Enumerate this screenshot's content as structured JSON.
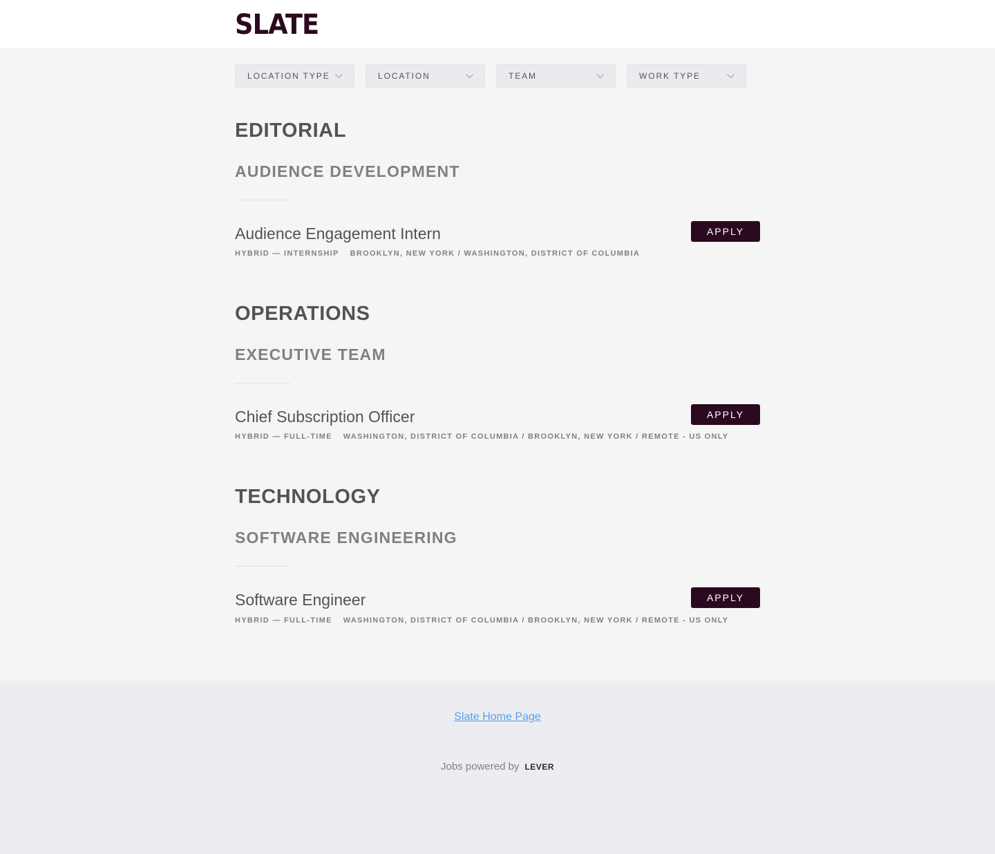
{
  "header": {
    "logo_text": "SLATE"
  },
  "filters": [
    {
      "label": "LOCATION TYPE"
    },
    {
      "label": "LOCATION"
    },
    {
      "label": "TEAM"
    },
    {
      "label": "WORK TYPE"
    }
  ],
  "groups": [
    {
      "department": "EDITORIAL",
      "team": "AUDIENCE DEVELOPMENT",
      "postings": [
        {
          "title": "Audience Engagement Intern",
          "commitment": "HYBRID — INTERNSHIP",
          "location": "BROOKLYN, NEW YORK / WASHINGTON, DISTRICT OF COLUMBIA",
          "apply_label": "APPLY"
        }
      ]
    },
    {
      "department": "OPERATIONS",
      "team": "EXECUTIVE TEAM",
      "postings": [
        {
          "title": "Chief Subscription Officer",
          "commitment": "HYBRID — FULL-TIME",
          "location": "WASHINGTON, DISTRICT OF COLUMBIA / BROOKLYN, NEW YORK / REMOTE - US ONLY",
          "apply_label": "APPLY"
        }
      ]
    },
    {
      "department": "TECHNOLOGY",
      "team": "SOFTWARE ENGINEERING",
      "postings": [
        {
          "title": "Software Engineer",
          "commitment": "HYBRID — FULL-TIME",
          "location": "WASHINGTON, DISTRICT OF COLUMBIA / BROOKLYN, NEW YORK / REMOTE - US ONLY",
          "apply_label": "APPLY"
        }
      ]
    }
  ],
  "footer": {
    "home_link": "Slate Home Page",
    "powered_by": "Jobs powered by",
    "lever_logo": "LEVER"
  },
  "colors": {
    "brand": "#2b0a20",
    "link": "#579eee",
    "background": "#f5f5f6",
    "footer_bg": "#ecedf1"
  }
}
